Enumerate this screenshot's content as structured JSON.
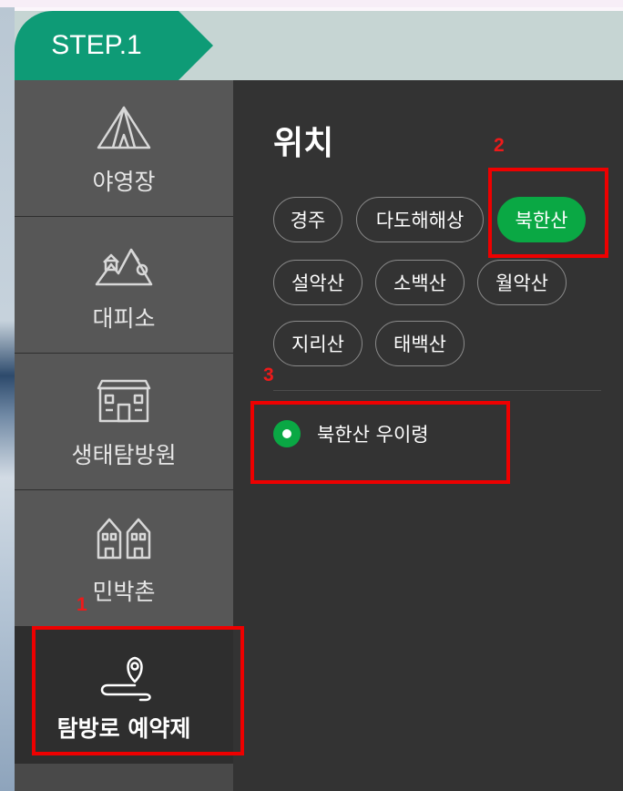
{
  "step": {
    "label": "STEP.1"
  },
  "sidebar": {
    "items": [
      {
        "label": "야영장",
        "icon": "tent-icon"
      },
      {
        "label": "대피소",
        "icon": "shelter-icon"
      },
      {
        "label": "생태탐방원",
        "icon": "building-icon"
      },
      {
        "label": "민박촌",
        "icon": "houses-icon"
      },
      {
        "label": "탐방로 예약제",
        "icon": "trail-map-pin-icon"
      }
    ],
    "active_index": 4
  },
  "location": {
    "title": "위치",
    "chips": [
      "경주",
      "다도해해상",
      "북한산",
      "설악산",
      "소백산",
      "월악산",
      "지리산",
      "태백산"
    ],
    "selected_chip": "북한산"
  },
  "trails": {
    "options": [
      "북한산 우이령"
    ],
    "selected": "북한산 우이령"
  },
  "annotations": [
    "1",
    "2",
    "3"
  ],
  "colors": {
    "brand_green": "#0e9b76",
    "selected_green": "#0aa844",
    "annotation_red": "#ee0000"
  }
}
